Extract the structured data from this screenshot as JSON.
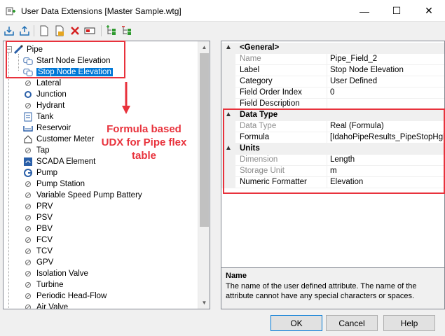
{
  "window": {
    "title": "User Data Extensions [Master Sample.wtg]",
    "minimize": "—",
    "maximize": "☐",
    "close": "✕"
  },
  "tree": {
    "items": [
      {
        "label": "Pipe",
        "icon": "pipe-icon"
      },
      {
        "label": "Start Node Elevation",
        "icon": "formula-icon"
      },
      {
        "label": "Stop Node Elevation",
        "icon": "formula-icon"
      },
      {
        "label": "Lateral",
        "icon": "element-icon"
      },
      {
        "label": "Junction",
        "icon": "junction-icon"
      },
      {
        "label": "Hydrant",
        "icon": "element-icon"
      },
      {
        "label": "Tank",
        "icon": "tank-icon"
      },
      {
        "label": "Reservoir",
        "icon": "reservoir-icon"
      },
      {
        "label": "Customer Meter",
        "icon": "house-icon"
      },
      {
        "label": "Tap",
        "icon": "element-icon"
      },
      {
        "label": "SCADA Element",
        "icon": "scada-icon"
      },
      {
        "label": "Pump",
        "icon": "pump-icon"
      },
      {
        "label": "Pump Station",
        "icon": "element-icon"
      },
      {
        "label": "Variable Speed Pump Battery",
        "icon": "element-icon"
      },
      {
        "label": "PRV",
        "icon": "element-icon"
      },
      {
        "label": "PSV",
        "icon": "element-icon"
      },
      {
        "label": "PBV",
        "icon": "element-icon"
      },
      {
        "label": "FCV",
        "icon": "element-icon"
      },
      {
        "label": "TCV",
        "icon": "element-icon"
      },
      {
        "label": "GPV",
        "icon": "element-icon"
      },
      {
        "label": "Isolation Valve",
        "icon": "element-icon"
      },
      {
        "label": "Turbine",
        "icon": "element-icon"
      },
      {
        "label": "Periodic Head-Flow",
        "icon": "element-icon"
      },
      {
        "label": "Air Valve",
        "icon": "element-icon"
      }
    ]
  },
  "annotation": {
    "text": "Formula based UDX for Pipe flex table",
    "color": "#e8323c"
  },
  "properties": {
    "general": {
      "header": "<General>",
      "rows": [
        {
          "name": "Name",
          "value": "Pipe_Field_2"
        },
        {
          "name": "Label",
          "value": "Stop Node Elevation"
        },
        {
          "name": "Category",
          "value": "User Defined"
        },
        {
          "name": "Field Order Index",
          "value": "0"
        },
        {
          "name": "Field Description",
          "value": ""
        }
      ]
    },
    "data_type": {
      "header": "Data Type",
      "rows": [
        {
          "name": "Data Type",
          "value": "Real (Formula)"
        },
        {
          "name": "Formula",
          "value": "[IdahoPipeResults_PipeStopHgl; N"
        }
      ]
    },
    "units": {
      "header": "Units",
      "rows": [
        {
          "name": "Dimension",
          "value": "Length"
        },
        {
          "name": "Storage Unit",
          "value": "m"
        },
        {
          "name": "Numeric Formatter",
          "value": "Elevation"
        }
      ]
    }
  },
  "description": {
    "title": "Name",
    "text": "The name of the user defined attribute.  The name of the attribute cannot have any special characters or spaces."
  },
  "buttons": {
    "ok": "OK",
    "cancel": "Cancel",
    "help": "Help"
  },
  "colors": {
    "selection": "#0078d7",
    "highlight_box": "#e8323c"
  }
}
